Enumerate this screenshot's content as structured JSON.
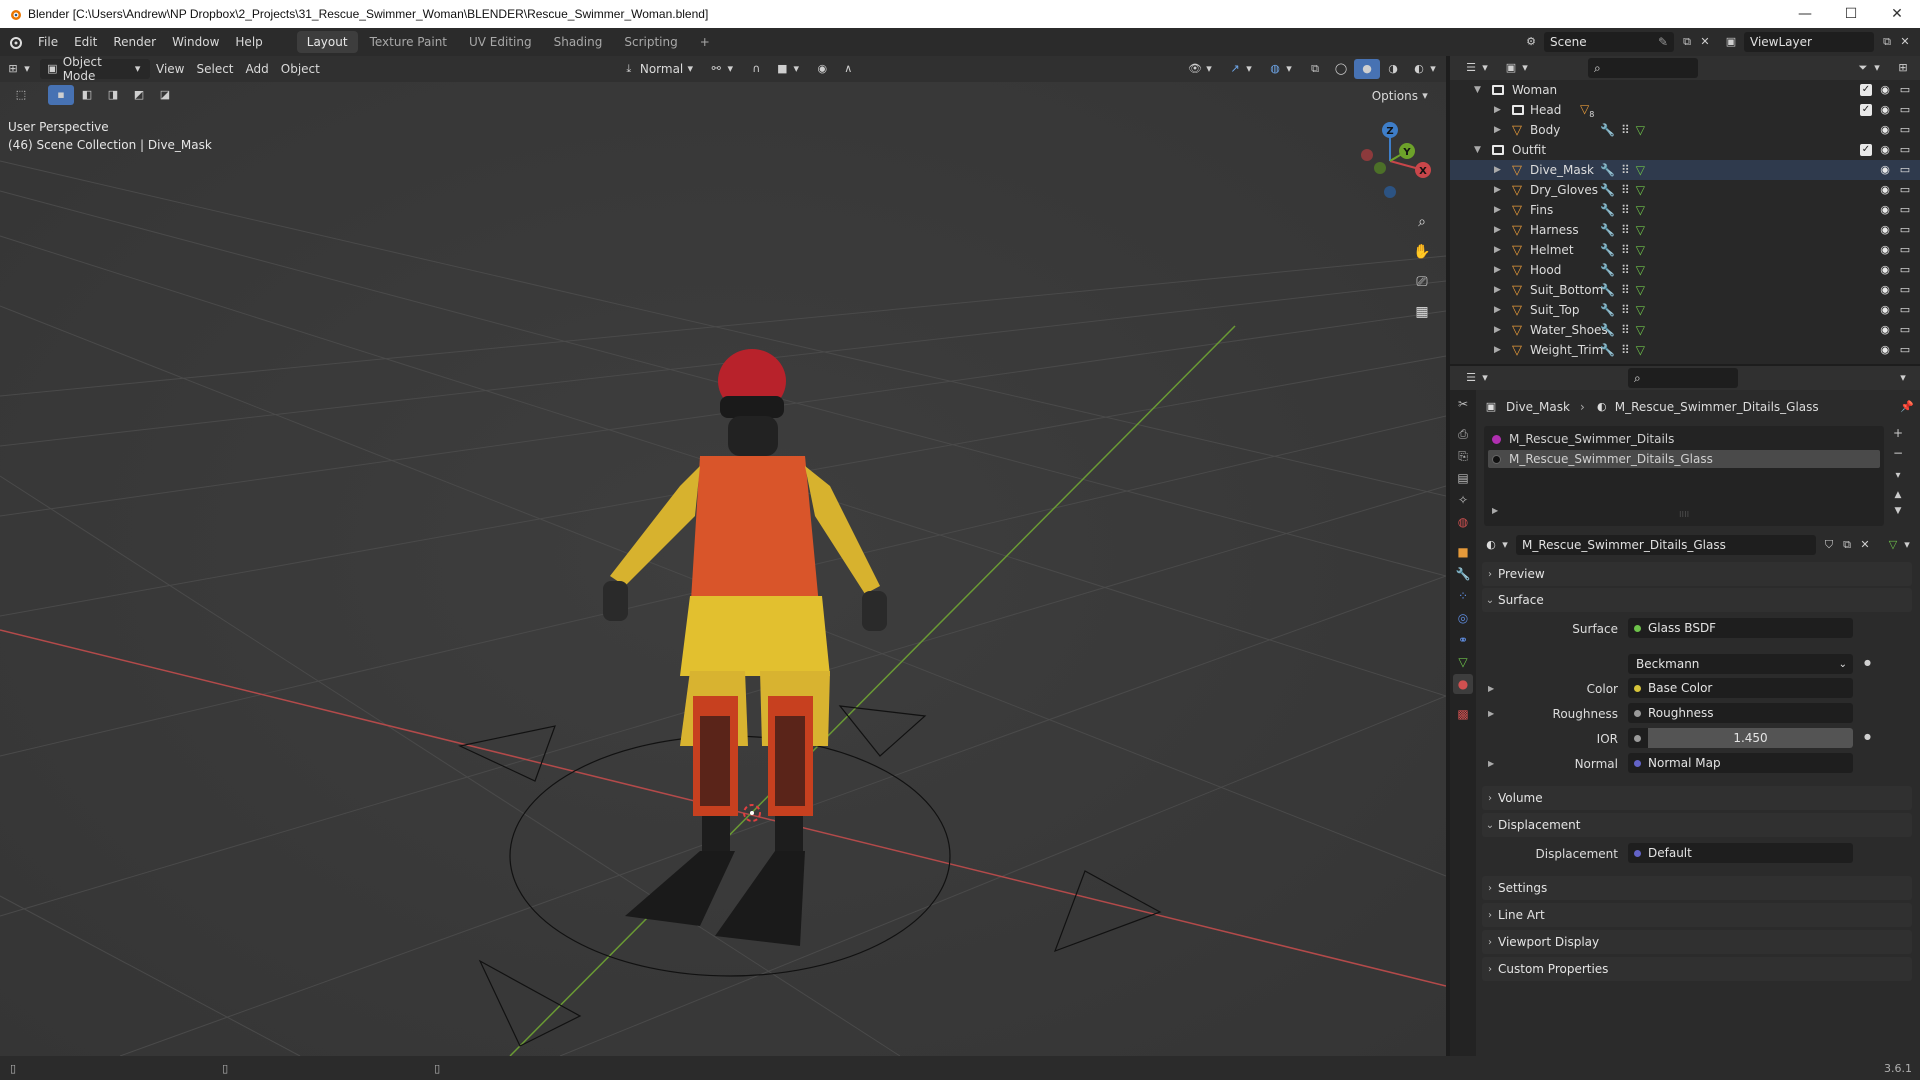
{
  "window": {
    "title": "Blender [C:\\Users\\Andrew\\NP Dropbox\\2_Projects\\31_Rescue_Swimmer_Woman\\BLENDER\\Rescue_Swimmer_Woman.blend]",
    "minimize": "—",
    "maximize": "☐",
    "close": "✕"
  },
  "menubar": {
    "menus": [
      "File",
      "Edit",
      "Render",
      "Window",
      "Help"
    ],
    "workspaces": [
      "Layout",
      "Texture Paint",
      "UV Editing",
      "Shading",
      "Scripting"
    ],
    "add_workspace": "+",
    "active_workspace": "Layout",
    "scene": "Scene",
    "view_layer": "ViewLayer"
  },
  "viewport": {
    "mode": "Object Mode",
    "menus": [
      "View",
      "Select",
      "Add",
      "Object"
    ],
    "orientation": "Normal",
    "options": "Options",
    "perspective": "User Perspective",
    "context": "(46) Scene Collection | Dive_Mask",
    "gizmo_labels": {
      "z": "Z",
      "y": "Y",
      "x": "X"
    }
  },
  "outliner": {
    "collections": [
      {
        "name": "Woman",
        "children": [
          {
            "name": "Head",
            "badge": "8"
          },
          {
            "name": "Body"
          }
        ]
      },
      {
        "name": "Outfit",
        "children": [
          {
            "name": "Dive_Mask"
          },
          {
            "name": "Dry_Gloves"
          },
          {
            "name": "Fins"
          },
          {
            "name": "Harness"
          },
          {
            "name": "Helmet"
          },
          {
            "name": "Hood"
          },
          {
            "name": "Suit_Bottom"
          },
          {
            "name": "Suit_Top"
          },
          {
            "name": "Water_Shoes"
          },
          {
            "name": "Weight_Trim"
          }
        ]
      }
    ]
  },
  "properties": {
    "breadcrumb_object": "Dive_Mask",
    "breadcrumb_material": "M_Rescue_Swimmer_Ditails_Glass",
    "material_slots": [
      "M_Rescue_Swimmer_Ditails",
      "M_Rescue_Swimmer_Ditails_Glass"
    ],
    "active_slot": 1,
    "material_name": "M_Rescue_Swimmer_Ditails_Glass",
    "sections": {
      "preview": "Preview",
      "surface": "Surface",
      "volume": "Volume",
      "displacement": "Displacement",
      "settings": "Settings",
      "line_art": "Line Art",
      "viewport_display": "Viewport Display",
      "custom_properties": "Custom Properties"
    },
    "surface": {
      "surface_label": "Surface",
      "surface_value": "Glass BSDF",
      "distribution": "Beckmann",
      "color_label": "Color",
      "color_value": "Base Color",
      "roughness_label": "Roughness",
      "roughness_value": "Roughness",
      "ior_label": "IOR",
      "ior_value": "1.450",
      "normal_label": "Normal",
      "normal_value": "Normal Map"
    },
    "displacement": {
      "label": "Displacement",
      "value": "Default"
    }
  },
  "statusbar": {
    "version": "3.6.1"
  },
  "colors": {
    "accent": "#4772b3",
    "mesh": "#e69a3a",
    "x_axis": "#c9464a",
    "y_axis": "#6da22a",
    "z_axis": "#3e7ec9"
  }
}
